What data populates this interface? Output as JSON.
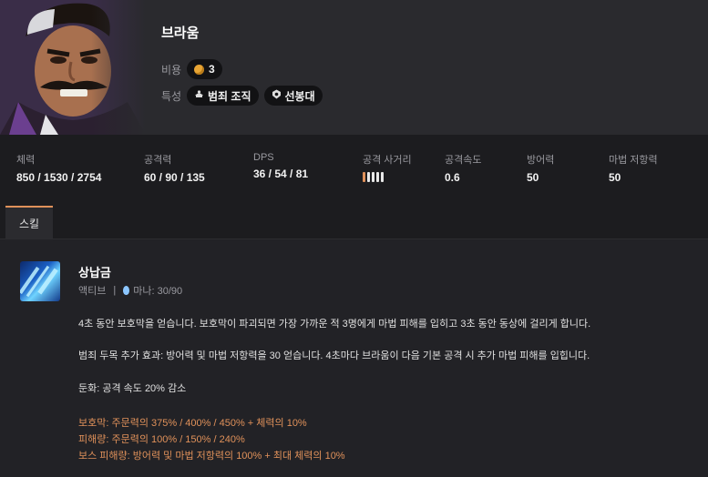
{
  "champion": {
    "name": "브라움",
    "cost_label": "비용",
    "cost": "3",
    "traits_label": "특성",
    "traits": [
      {
        "name": "범죄 조직",
        "icon": "crime-syndicate-icon"
      },
      {
        "name": "선봉대",
        "icon": "vanguard-icon"
      }
    ]
  },
  "stats": [
    {
      "label": "체력",
      "value": "850 / 1530 / 2754"
    },
    {
      "label": "공격력",
      "value": "60 / 90 / 135"
    },
    {
      "label": "DPS",
      "value": "36 / 54 / 81"
    },
    {
      "label": "공격 사거리",
      "range_level": 1,
      "range_max": 5
    },
    {
      "label": "공격속도",
      "value": "0.6"
    },
    {
      "label": "방어력",
      "value": "50"
    },
    {
      "label": "마법 저항력",
      "value": "50"
    }
  ],
  "tabs": [
    {
      "label": "스킬",
      "active": true
    }
  ],
  "skill": {
    "name": "상납금",
    "type": "액티브",
    "separator": "|",
    "mana": "마나: 30/90",
    "description": [
      "4초 동안 보호막을 얻습니다. 보호막이 파괴되면 가장 가까운 적 3명에게 마법 피해를 입히고 3초 동안 동상에 걸리게 합니다.",
      "범죄 두목 추가 효과: 방어력 및 마법 저항력을 30 얻습니다. 4초마다 브라움이 다음 기본 공격 시 추가 마법 피해를 입힙니다.",
      "둔화: 공격 속도 20% 감소"
    ],
    "scalings": [
      "보호막: 주문력의 375% / 400% / 450% + 체력의 10%",
      "피해량: 주문력의 100% / 150% / 240%",
      "보스 피해량: 방어력 및 마법 저항력의 100% + 최대 체력의 10%"
    ]
  },
  "colors": {
    "accent": "#e0915a",
    "background": "#1c1c1f",
    "header": "#2a2a2e",
    "panel": "#222226"
  }
}
